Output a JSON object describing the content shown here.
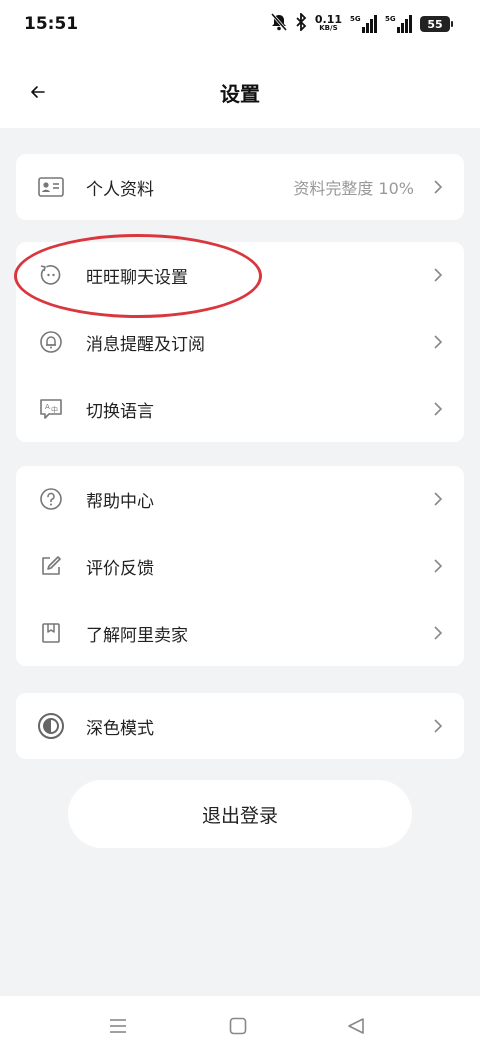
{
  "status_bar": {
    "time": "15:51",
    "net_speed_value": "0.11",
    "net_speed_unit": "KB/S",
    "sim1_label": "5G",
    "sim2_label": "5G",
    "battery": "55",
    "icons": [
      "mute-icon",
      "bluetooth-icon",
      "signal-icon",
      "battery-icon"
    ]
  },
  "header": {
    "title": "设置",
    "back_icon": "back-arrow-icon"
  },
  "groups": [
    {
      "items": [
        {
          "label": "个人资料",
          "extra": "资料完整度 10%",
          "icon": "id-card-icon"
        }
      ]
    },
    {
      "items": [
        {
          "label": "旺旺聊天设置",
          "icon": "wangwang-chat-icon"
        },
        {
          "label": "消息提醒及订阅",
          "icon": "bell-icon"
        },
        {
          "label": "切换语言",
          "icon": "language-icon"
        }
      ]
    },
    {
      "items": [
        {
          "label": "帮助中心",
          "icon": "help-icon"
        },
        {
          "label": "评价反馈",
          "icon": "edit-feedback-icon"
        },
        {
          "label": "了解阿里卖家",
          "icon": "book-icon"
        }
      ]
    },
    {
      "items": [
        {
          "label": "深色模式",
          "icon": "dark-mode-icon"
        }
      ]
    }
  ],
  "logout_label": "退出登录",
  "annotation": {
    "color": "#d9363e"
  },
  "colors": {
    "background": "#f2f3f5",
    "card": "#ffffff",
    "text": "#222222",
    "muted": "#999999"
  },
  "system_nav": {
    "icons": [
      "menu-icon",
      "home-icon",
      "back-triangle-icon"
    ]
  }
}
